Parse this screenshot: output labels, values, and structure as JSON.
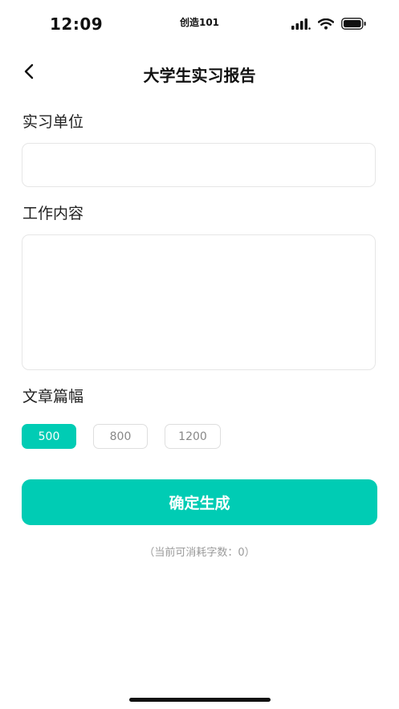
{
  "status_bar": {
    "time": "12:09",
    "carrier": "创造101",
    "icons": [
      "cellular-signal-icon",
      "wifi-icon",
      "battery-icon"
    ]
  },
  "nav": {
    "back_icon": "chevron-left-icon",
    "title": "大学生实习报告"
  },
  "form": {
    "unit_label": "实习单位",
    "unit_value": "",
    "content_label": "工作内容",
    "content_value": "",
    "length_label": "文章篇幅",
    "length_options": [
      "500",
      "800",
      "1200"
    ],
    "selected_length": "500"
  },
  "confirm_label": "确定生成",
  "usage_text": "（当前可消耗字数：0）",
  "colors": {
    "accent": "#00ccb4",
    "text": "#111111",
    "muted": "#9a9a9a",
    "border": "#e6e6e6"
  }
}
